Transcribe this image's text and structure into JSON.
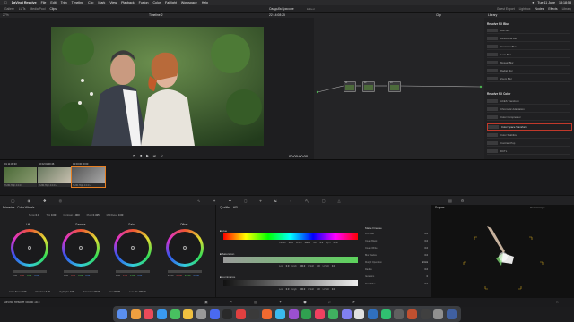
{
  "menubar": {
    "items": [
      "DaVinci Resolve",
      "File",
      "Edit",
      "Trim",
      "Timeline",
      "Clip",
      "Mark",
      "View",
      "Playback",
      "Fusion",
      "Color",
      "Fairlight",
      "Workspace",
      "Help"
    ],
    "right": [
      "Tue 11 June",
      "18:18:58"
    ]
  },
  "toolbar": {
    "left": [
      "Gallery",
      "LUTs",
      "Media Pool",
      "Clips"
    ],
    "right": [
      "Guest Export",
      "Lightbox",
      "Nodes",
      "Effects",
      "Library"
    ]
  },
  "viewer": {
    "zoom": "27%",
    "timeline": "Timeline 2",
    "project": "Свадьба Крисоне",
    "status": "Edited",
    "timecode_top": "22:14:08:25",
    "timecode": "00:00:00:00"
  },
  "nodes": {
    "title": "Clip",
    "items": [
      {
        "num": "01"
      },
      {
        "num": "02"
      },
      {
        "num": "03"
      }
    ]
  },
  "library": {
    "title": "Library",
    "section1": "Resolve FX Blur",
    "blur_items": [
      "Box Blur",
      "Directional Blur",
      "Gaussian Blur",
      "Lens Blur",
      "Mosaic Blur",
      "Radial Blur",
      "Zoom Blur"
    ],
    "section2": "Resolve FX Color",
    "color_items": [
      "ACES Transform",
      "Chromatic Adaptation",
      "Color Compressor",
      "Color Space Transform",
      "Color Stabilizer",
      "Contrast Pop",
      "DCTL"
    ],
    "selected": "Color Space Transform"
  },
  "clips": [
    {
      "tc": "01",
      "time": "11:30:33",
      "name": "H.264 High 4:2:2 L"
    },
    {
      "tc": "02",
      "time": "02:01:30:46",
      "name": "H.264 High 4:2:2 L"
    },
    {
      "tc": "03",
      "time": "00:00:00:00",
      "name": "H.264 High 4:2:2 L"
    }
  ],
  "wheels": {
    "title": "Primaries - Color Wheels",
    "temp": "0.0",
    "tint": "0.00",
    "contrast": "1.000",
    "pivot": "0.435",
    "mid_detail": "0.00",
    "labels": [
      "Lift",
      "Gamma",
      "Gain",
      "Offset"
    ],
    "values": [
      [
        "0.00",
        "0.00",
        "0.00",
        "0.00"
      ],
      [
        "0.00",
        "0.00",
        "0.00",
        "0.00"
      ],
      [
        "1.00",
        "1.00",
        "1.00",
        "1.00"
      ],
      [
        "25.00",
        "25.00",
        "25.00",
        "25.00"
      ]
    ],
    "bottom": {
      "color_boost": "0.00",
      "shadows": "0.00",
      "highlights": "0.00",
      "saturation": "50.00",
      "hue": "50.00",
      "lum_mix": "100.00"
    }
  },
  "qualifier": {
    "title": "Qualifier - HSL",
    "hue": "Hue",
    "saturation": "Saturation",
    "luminance": "Luminance",
    "hue_vals": [
      "Center",
      "50.0",
      "Width",
      "100.0",
      "Soft",
      "0.0",
      "Sym",
      "50.0"
    ],
    "sat_vals": [
      "Low",
      "0.0",
      "High",
      "100.0",
      "L.Soft",
      "0.0",
      "H.Soft",
      "0.0"
    ],
    "lum_vals": [
      "Low",
      "0.0",
      "High",
      "100.0",
      "L.Soft",
      "0.0",
      "H.Soft",
      "0.0"
    ],
    "matte_title": "Matte Finesse",
    "matte_rows": [
      [
        "Pre-Filter",
        "0.0"
      ],
      [
        "Clean Black",
        "0.0"
      ],
      [
        "Clean White",
        "0.0"
      ],
      [
        "Blur Radius",
        "0.0"
      ],
      [
        "Morph Operation",
        "Shrink"
      ],
      [
        "Radius",
        "0.0"
      ],
      [
        "Iterations",
        "0"
      ],
      [
        "Post-Filter",
        "0.0"
      ]
    ]
  },
  "scopes": {
    "title": "Scopes",
    "mode": "Vectorscope"
  },
  "status": {
    "app": "DaVinci Resolve Studio 18.5"
  },
  "dock": {
    "colors": [
      "#5a8ff0",
      "#f0a040",
      "#ea4a5a",
      "#3a9af0",
      "#48c060",
      "#f0c040",
      "#999",
      "#4a6af0",
      "#2a2a2a",
      "#e04040",
      "#3a3a3a",
      "#f06a30",
      "#3abaf0",
      "#9a50d0",
      "#30a050",
      "#f04060",
      "#40b060",
      "#8080f0",
      "#e0e0e0",
      "#3070c0",
      "#30c070",
      "#606060",
      "#c05030",
      "#404040",
      "#909090",
      "#4060a0"
    ]
  }
}
